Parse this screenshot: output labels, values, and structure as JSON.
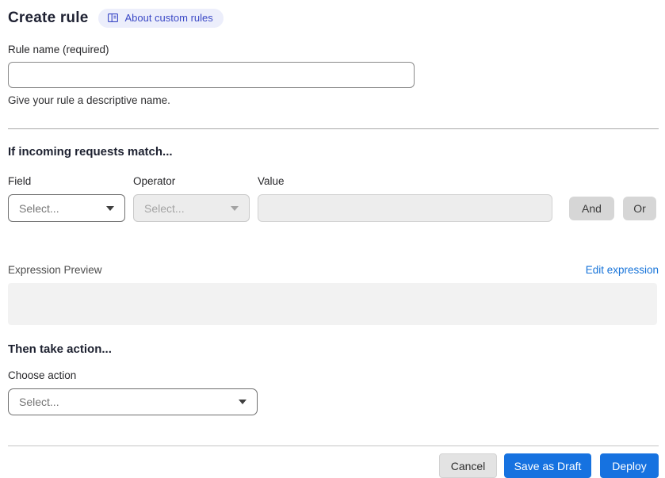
{
  "header": {
    "title": "Create rule",
    "about_badge_label": "About custom rules"
  },
  "rule_name": {
    "label": "Rule name (required)",
    "value": "",
    "help": "Give your rule a descriptive name."
  },
  "match_section": {
    "heading": "If incoming requests match...",
    "field_label": "Field",
    "field_placeholder": "Select...",
    "operator_label": "Operator",
    "operator_placeholder": "Select...",
    "value_label": "Value",
    "value_text": "",
    "and_label": "And",
    "or_label": "Or",
    "expression_preview_label": "Expression Preview",
    "edit_expression_label": "Edit expression",
    "expression_value": ""
  },
  "action_section": {
    "heading": "Then take action...",
    "choose_action_label": "Choose action",
    "action_placeholder": "Select..."
  },
  "footer": {
    "cancel_label": "Cancel",
    "save_draft_label": "Save as Draft",
    "deploy_label": "Deploy"
  },
  "colors": {
    "primary_blue": "#1672e0",
    "link_blue": "#1673d9",
    "badge_bg": "#eceefb",
    "badge_text": "#3b49c6",
    "heading_text": "#1d2130",
    "disabled_bg": "#ececec",
    "preview_bg": "#f2f2f2",
    "divider": "#a9a9a9"
  }
}
